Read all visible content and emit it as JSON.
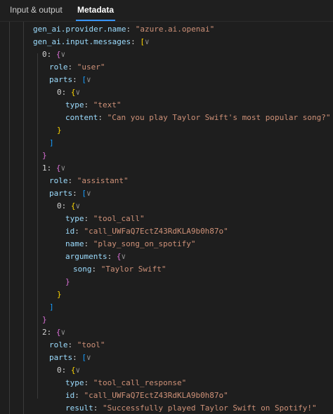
{
  "tabs": [
    {
      "label": "Input & output"
    },
    {
      "label": "Metadata"
    }
  ],
  "code": {
    "provider_key": "gen_ai.provider.name",
    "provider_value": "\"azure.ai.openai\"",
    "messages_key": "gen_ai.input.messages",
    "messages": [
      {
        "index": "0",
        "role": "\"user\"",
        "part": {
          "index": "0",
          "type": "\"text\"",
          "content": "\"Can you play Taylor Swift's most popular song?\""
        }
      },
      {
        "index": "1",
        "role": "\"assistant\"",
        "part": {
          "index": "0",
          "type": "\"tool_call\"",
          "id": "\"call_UWFaQ7EctZ43RdKLA9b0h87o\"",
          "name": "\"play_song_on_spotify\"",
          "arg_song": "\"Taylor Swift\""
        }
      },
      {
        "index": "2",
        "role": "\"tool\"",
        "part": {
          "index": "0",
          "type": "\"tool_call_response\"",
          "id": "\"call_UWFaQ7EctZ43RdKLA9b0h87o\"",
          "result": "\"Successfully played Taylor Swift on Spotify!\""
        }
      }
    ],
    "keys": {
      "role": "role",
      "parts": "parts",
      "type": "type",
      "content": "content",
      "id": "id",
      "name": "name",
      "arguments": "arguments",
      "song": "song",
      "result": "result"
    }
  },
  "colors": {
    "background": "#1e1e1e",
    "key": "#9cdcfe",
    "string": "#ce9178",
    "bracket_level_1": "#ffd700",
    "bracket_level_2": "#da70d6",
    "bracket_level_3": "#179fff",
    "active_tab_underline": "#3794ff"
  },
  "icons": {
    "collapse": "chevron-down-icon"
  }
}
